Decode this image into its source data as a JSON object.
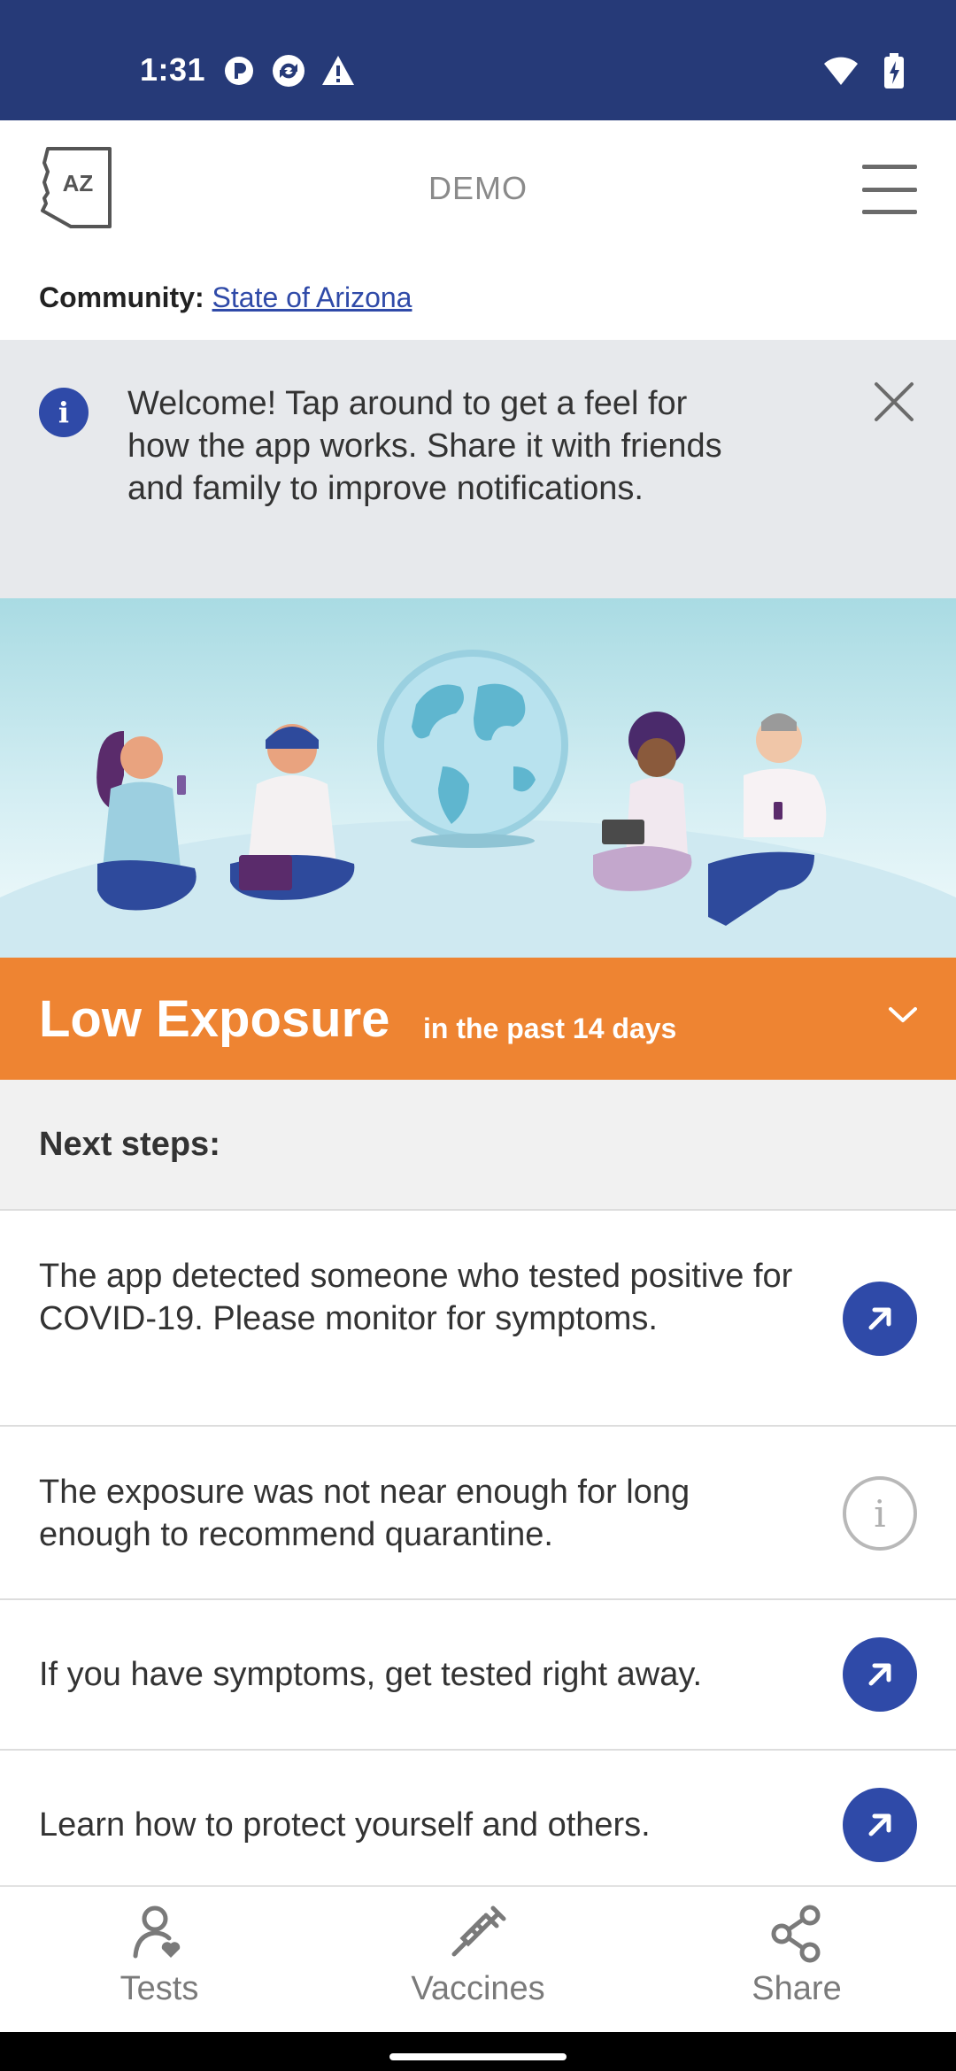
{
  "status_bar": {
    "time": "1:31",
    "left_icons": [
      "notification-p-icon",
      "sync-icon",
      "warning-icon"
    ],
    "right_icons": [
      "wifi-icon",
      "battery-charging-icon"
    ]
  },
  "header": {
    "logo_text": "AZ",
    "title": "DEMO",
    "menu_icon": "hamburger-menu-icon"
  },
  "community": {
    "label": "Community:",
    "link": "State of Arizona"
  },
  "welcome_banner": {
    "text": "Welcome! Tap around to get a feel for how the app works. Share it with friends and family to improve notifications.",
    "info_glyph": "i"
  },
  "exposure": {
    "title": "Low Exposure",
    "subtitle": "in the past 14 days",
    "color": "#ee8432"
  },
  "next_steps": {
    "label": "Next steps:",
    "items": [
      {
        "text": "The app detected someone who tested positive for COVID-19. Please monitor for symptoms.",
        "icon": "external-link-arrow-icon"
      },
      {
        "text": "The exposure was not near enough for long enough to recommend quarantine.",
        "icon": "info-outline-icon",
        "glyph": "i"
      },
      {
        "text": "If you have symptoms, get tested right away.",
        "icon": "external-link-arrow-icon"
      },
      {
        "text": "Learn how to protect yourself and others.",
        "icon": "external-link-arrow-icon"
      }
    ]
  },
  "bottom_nav": [
    {
      "label": "Tests",
      "icon": "person-heart-icon"
    },
    {
      "label": "Vaccines",
      "icon": "syringe-icon"
    },
    {
      "label": "Share",
      "icon": "share-icon"
    }
  ],
  "colors": {
    "brand_blue": "#263a78",
    "accent_blue": "#2f4aa8",
    "banner_gray": "#e7e9ec"
  }
}
